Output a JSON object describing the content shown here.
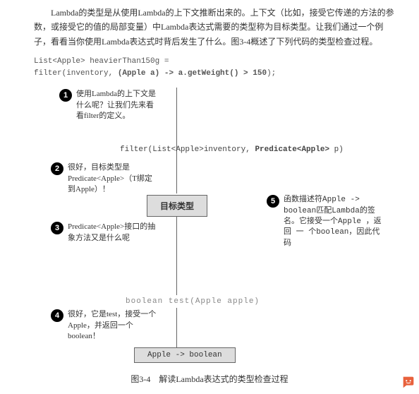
{
  "intro": "Lambda的类型是从使用Lambda的上下文推断出来的。上下文（比如，接受它传递的方法的参数，或接受它的值的局部变量）中Lambda表达式需要的类型称为目标类型。让我们通过一个例子，看看当你使用Lambda表达式时背后发生了什么。图3-4概述了下列代码的类型检查过程。",
  "code": {
    "line1": "List<Apple> heavierThan150g =",
    "line2_pre": "        filter(inventory, ",
    "line2_bold": "(Apple a) -> a.getWeight() > 150",
    "line2_post": ");"
  },
  "steps": {
    "s1": {
      "num": "1",
      "text": "使用Lambda的上下文是什么呢？让我们先来看看filter的定义。"
    },
    "s2": {
      "num": "2",
      "text": "很好，目标类型是Predicate<Apple>（T绑定到Apple）！"
    },
    "s3": {
      "num": "3",
      "text": "Predicate<Apple>接口的抽象方法又是什么呢"
    },
    "s4": {
      "num": "4",
      "text": "很好，它是test，接受一个Apple，并返回一个boolean！"
    },
    "s5": {
      "num": "5",
      "text": "函数描述符Apple -> boolean匹配Lambda的签名。它接受一个Apple ，返 回 一 个boolean，因此代码"
    }
  },
  "sig1_pre": "filter(List<Apple>inventory, ",
  "sig1_bold": "Predicate<Apple>",
  "sig1_post": " p)",
  "target_label": "目标类型",
  "sig2": "boolean test(Apple apple)",
  "sig3": "Apple -> boolean",
  "caption": "图3-4　解读Lambda表达式的类型检查过程"
}
